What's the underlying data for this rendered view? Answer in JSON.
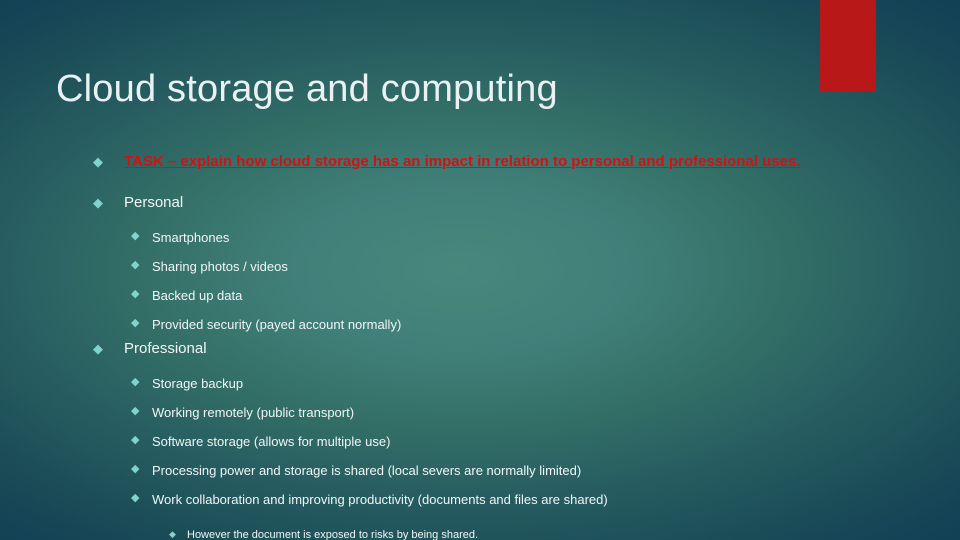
{
  "slide": {
    "title": "Cloud storage and computing",
    "accent_color": "#b81818",
    "background_center_color": "#41807a",
    "background_edge_color": "#17485a",
    "title_color": "#e9f1f3",
    "bullet_glyph": "◆",
    "bullet_color": "#7fd4cc",
    "body_text_color": "#f0f6f7",
    "task_text_color": "#d41111"
  },
  "content": {
    "task": {
      "label": "TASK – explain how cloud storage has an impact in relation to personal and professional uses."
    },
    "sections": [
      {
        "heading": "Personal",
        "items": [
          {
            "label": "Smartphones"
          },
          {
            "label": "Sharing photos / videos"
          },
          {
            "label": "Backed up data"
          },
          {
            "label": "Provided security (payed account normally)"
          }
        ]
      },
      {
        "heading": "Professional",
        "items": [
          {
            "label": "Storage backup"
          },
          {
            "label": "Working remotely (public transport)"
          },
          {
            "label": "Software storage (allows for multiple use)"
          },
          {
            "label": "Processing power and storage is shared (local severs are normally limited)"
          },
          {
            "label": "Work collaboration and improving productivity (documents and files are shared)",
            "sub": [
              {
                "label": "However the document is exposed to risks by being shared."
              }
            ]
          }
        ]
      }
    ]
  }
}
